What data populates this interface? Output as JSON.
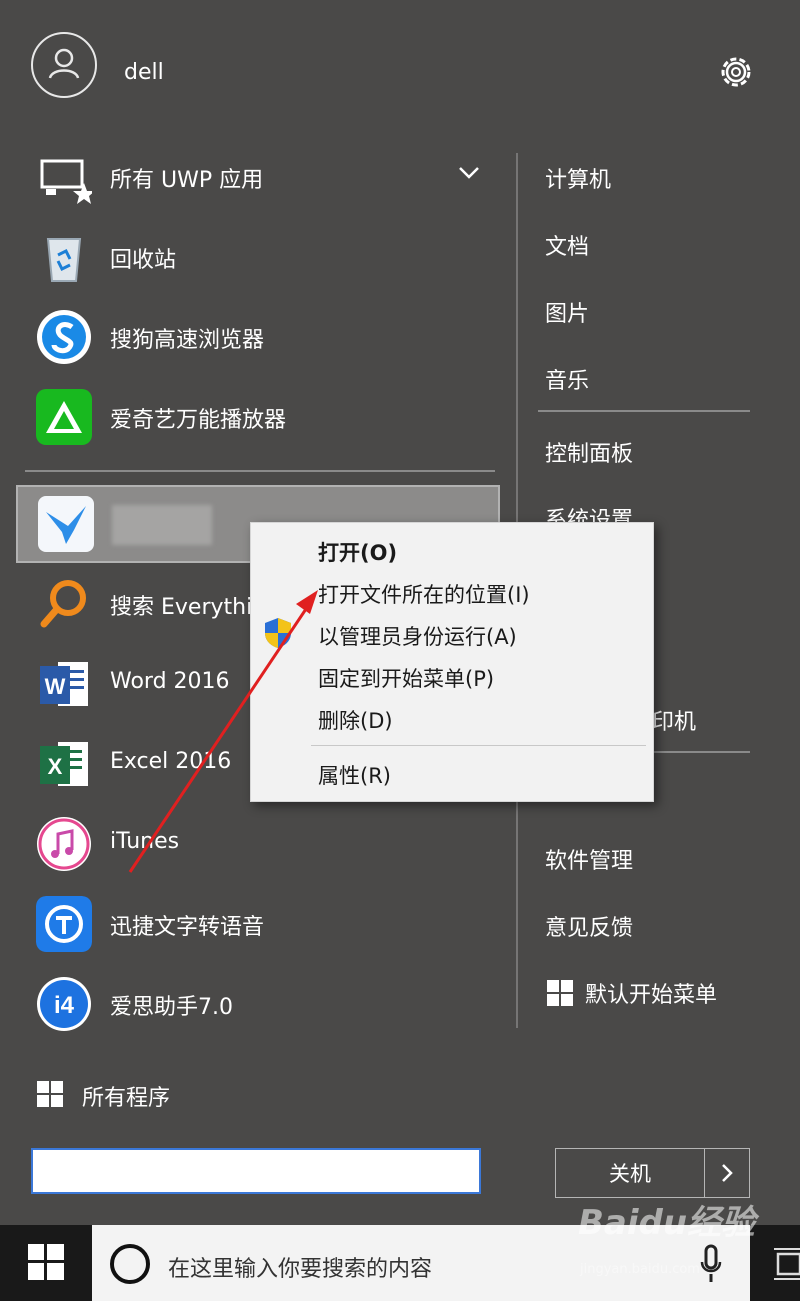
{
  "user": {
    "name": "dell"
  },
  "left_items": [
    {
      "label": "所有 UWP 应用",
      "icon": "uwp-apps-icon"
    },
    {
      "label": "回收站",
      "icon": "recycle-bin-icon"
    },
    {
      "label": "搜狗高速浏览器",
      "icon": "sogou-browser-icon"
    },
    {
      "label": "爱奇艺万能播放器",
      "icon": "iqiyi-player-icon"
    },
    {
      "label": "",
      "icon": "app-bird-icon"
    },
    {
      "label": "搜索 Everythi",
      "icon": "everything-search-icon"
    },
    {
      "label": "Word 2016",
      "icon": "word-icon"
    },
    {
      "label": "Excel 2016",
      "icon": "excel-icon"
    },
    {
      "label": "iTunes",
      "icon": "itunes-icon"
    },
    {
      "label": "迅捷文字转语音",
      "icon": "xunjie-tts-icon"
    },
    {
      "label": "爱思助手7.0",
      "icon": "i4-assistant-icon"
    }
  ],
  "right_items": [
    {
      "label": "计算机"
    },
    {
      "label": "文档"
    },
    {
      "label": "图片"
    },
    {
      "label": "音乐"
    },
    {
      "label": "控制面板"
    },
    {
      "label": "系统设置"
    },
    {
      "label": "印机"
    },
    {
      "label": "软件管理"
    },
    {
      "label": "意见反馈"
    },
    {
      "label": "默认开始菜单"
    }
  ],
  "context_menu": {
    "items": [
      {
        "label": "打开(O)",
        "bold": true
      },
      {
        "label": "打开文件所在的位置(I)"
      },
      {
        "label": "以管理员身份运行(A)",
        "icon": "uac-shield-icon"
      },
      {
        "label": "固定到开始菜单(P)"
      },
      {
        "label": "删除(D)"
      },
      {
        "label": "属性(R)"
      }
    ]
  },
  "bottom": {
    "all_programs": "所有程序",
    "shutdown": "关机"
  },
  "taskbar": {
    "search_placeholder": "在这里输入你要搜索的内容"
  },
  "watermark": {
    "text": "Baidu经验",
    "sub": "jingyan.baidu.com"
  },
  "colors": {
    "menu_bg": "#4a4948",
    "highlight": "#8c8b8a",
    "accent": "#3b78d8",
    "annotation_arrow": "#e02020"
  }
}
